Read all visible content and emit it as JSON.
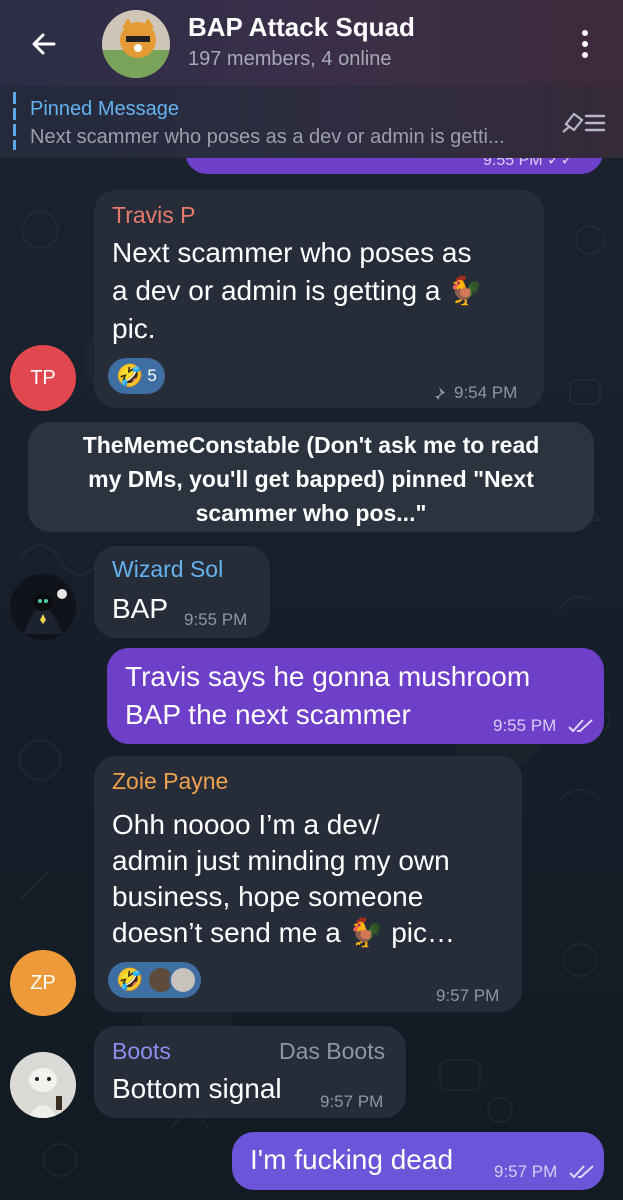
{
  "header": {
    "back_icon": "arrow-left-icon",
    "title": "BAP Attack Squad",
    "subtitle": "197 members, 4 online",
    "menu_icon": "more-vertical-icon"
  },
  "pinned": {
    "label": "Pinned Message",
    "text": "Next scammer who poses as a dev or admin is getti...",
    "action_icon": "unpin-list-icon"
  },
  "messages": [
    {
      "sender": "Travis P",
      "sender_color": "#e87b6e",
      "lines": [
        "Next scammer who poses as",
        "a dev or admin is getting a 🐓",
        "pic."
      ],
      "reaction": {
        "emoji": "🤣",
        "count": "5"
      },
      "time": "9:54 PM",
      "avatar_initials": "TP",
      "avatar_color": "#e0474f"
    },
    {
      "service_lines": [
        "TheMemeConstable (Don't ask me to read",
        "my DMs, you'll get bapped) pinned \"Next",
        "scammer who pos...\""
      ]
    },
    {
      "sender": "Wizard Sol",
      "sender_color": "#64b2ee",
      "text": "BAP",
      "time": "9:55 PM"
    },
    {
      "lines": [
        "Travis says he gonna mushroom",
        "BAP the next scammer"
      ],
      "time": "9:55 PM",
      "outgoing": true
    },
    {
      "sender": "Zoie Payne",
      "sender_color": "#f0a14e",
      "lines": [
        "Ohh noooo I’m a dev/",
        "admin just minding my own",
        "business, hope someone",
        "doesn’t send me a 🐓 pic…"
      ],
      "reaction": {
        "emoji": "🤣"
      },
      "time": "9:57 PM",
      "avatar_initials": "ZP",
      "avatar_color": "#ef9a3a"
    },
    {
      "sender": "Boots",
      "sender_color": "#8e8ef0",
      "title": "Das Boots",
      "text": "Bottom signal",
      "time": "9:57 PM"
    },
    {
      "text": "I'm fucking dead",
      "time": "9:57 PM",
      "outgoing": true
    }
  ],
  "colors": {
    "header_bg": "#2f2c45",
    "incoming_bubble": "#262d38",
    "outgoing_bubble": "#6e3fc8",
    "accent": "#64b2ee"
  }
}
